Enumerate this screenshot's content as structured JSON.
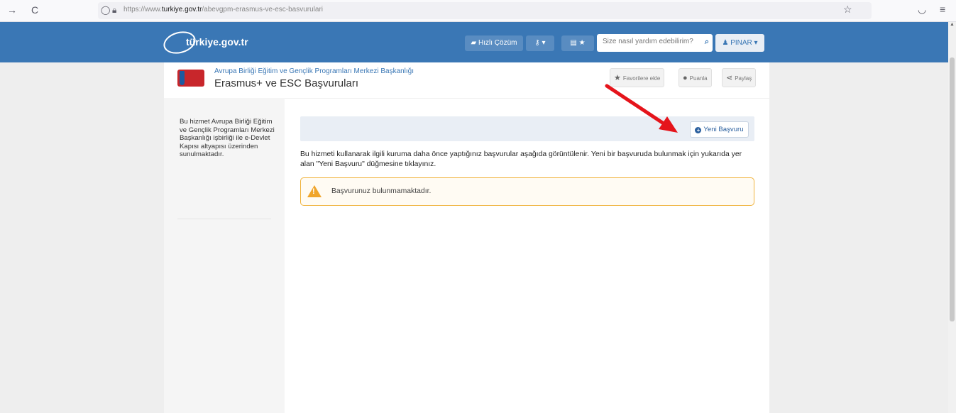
{
  "browser": {
    "url_prefix": "https://www.",
    "url_domain": "turkiye.gov.tr",
    "url_path": "/abevgpm-erasmus-ve-esc-basvurulari",
    "forward_glyph": "→",
    "reload_glyph": "C",
    "star_glyph": "☆"
  },
  "header": {
    "logo_text": "türkiye.gov.tr",
    "quick_solution_label": "Hızlı Çözüm",
    "search_placeholder": "Size nasıl yardım edebilirim?",
    "user_label": "PINAR"
  },
  "institution": {
    "name": "Avrupa Birliği Eğitim ve Gençlik Programları Merkezi Başkanlığı",
    "page_title": "Erasmus+ ve ESC Başvuruları"
  },
  "actions": {
    "favorite_label": "Favorilere ekle",
    "rate_label": "Puanla",
    "share_label": "Paylaş"
  },
  "sidebar": {
    "text": "Bu hizmet Avrupa Birliği Eğitim ve Gençlik Programları Merkezi Başkanlığı işbirliği ile e-Devlet Kapısı altyapısı üzerinden sunulmaktadır."
  },
  "main": {
    "new_application_label": "Yeni Başvuru",
    "info_text": "Bu hizmeti kullanarak ilgili kuruma daha önce yaptığınız başvurular aşağıda görüntülenir. Yeni bir başvuruda bulunmak için yukarıda yer alan \"Yeni Başvuru\" düğmesine tıklayınız.",
    "alert_text": "Başvurunuz bulunmamaktadır."
  },
  "colors": {
    "header_blue": "#3a77b5",
    "alert_border": "#f0b33d",
    "arrow_red": "#e5141b"
  }
}
